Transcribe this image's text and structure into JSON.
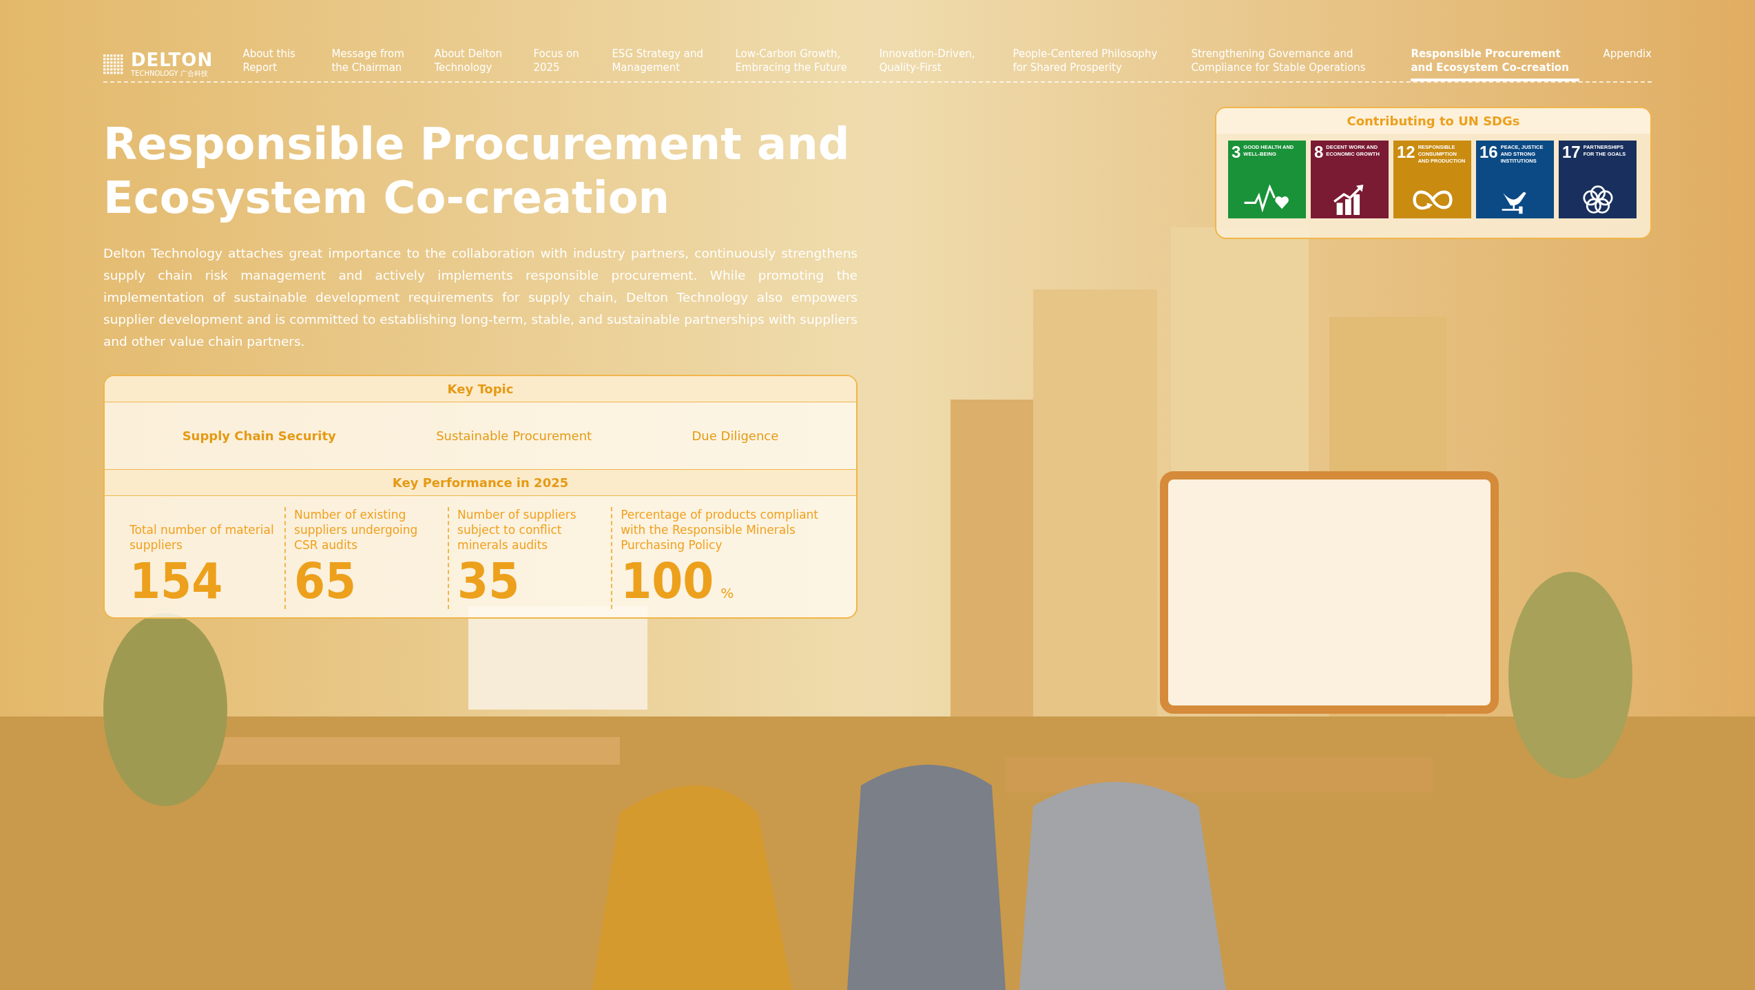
{
  "logo": {
    "name": "DELTON",
    "subtitle": "TECHNOLOGY 广合科技"
  },
  "nav": [
    {
      "label": "About this Report",
      "selected": false
    },
    {
      "label": "Message from the Chairman",
      "selected": false
    },
    {
      "label": "About Delton Technology",
      "selected": false
    },
    {
      "label": "Focus on 2025",
      "selected": false
    },
    {
      "label": "ESG Strategy and Management",
      "selected": false
    },
    {
      "label": "Low-Carbon Growth, Embracing the Future",
      "selected": false
    },
    {
      "label": "Innovation-Driven, Quality-First",
      "selected": false
    },
    {
      "label": "People-Centered Philosophy for Shared Prosperity",
      "selected": false
    },
    {
      "label": "Strengthening Governance and Compliance for Stable Operations",
      "selected": false
    },
    {
      "label": "Responsible Procurement and Ecosystem Co-creation",
      "selected": true
    },
    {
      "label": "Appendix",
      "selected": false
    }
  ],
  "title": "Responsible Procurement and Ecosystem Co-creation",
  "intro": "Delton Technology attaches great importance to the collaboration with industry partners, continuously strengthens supply chain risk management and actively implements responsible procurement. While promoting the implementation of sustainable development requirements for supply chain, Delton Technology also empowers supplier development and is committed to establishing long-term, stable, and sustainable partnerships with suppliers and other value chain partners.",
  "key_topic": {
    "heading": "Key Topic",
    "topics": [
      {
        "label": "Supply Chain Security",
        "selected": true
      },
      {
        "label": "Sustainable Procurement",
        "selected": false
      },
      {
        "label": "Due Diligence",
        "selected": false
      }
    ]
  },
  "key_performance": {
    "heading": "Key Performance in 2025",
    "metrics": [
      {
        "label": "Total number of material suppliers",
        "value": "154"
      },
      {
        "label": "Number of existing suppliers undergoing CSR audits",
        "value": "65"
      },
      {
        "label": "Number of suppliers subject to conflict minerals audits",
        "value": "35"
      },
      {
        "label": "Percentage of products compliant with the Responsible Minerals Purchasing Policy",
        "value": "100",
        "unit": "%"
      }
    ]
  },
  "sdgs": {
    "heading": "Contributing to UN SDGs",
    "goals": [
      {
        "number": "3",
        "title": "GOOD HEALTH AND WELL-BEING",
        "color": "#1a9239",
        "kind": "health"
      },
      {
        "number": "8",
        "title": "DECENT WORK AND ECONOMIC GROWTH",
        "color": "#7a1a33",
        "kind": "growth"
      },
      {
        "number": "12",
        "title": "RESPONSIBLE CONSUMPTION AND PRODUCTION",
        "color": "#c98b10",
        "kind": "infinity"
      },
      {
        "number": "16",
        "title": "PEACE, JUSTICE AND STRONG INSTITUTIONS",
        "color": "#0b4a84",
        "kind": "dove"
      },
      {
        "number": "17",
        "title": "PARTNERSHIPS FOR THE GOALS",
        "color": "#19305e",
        "kind": "rings"
      }
    ]
  }
}
